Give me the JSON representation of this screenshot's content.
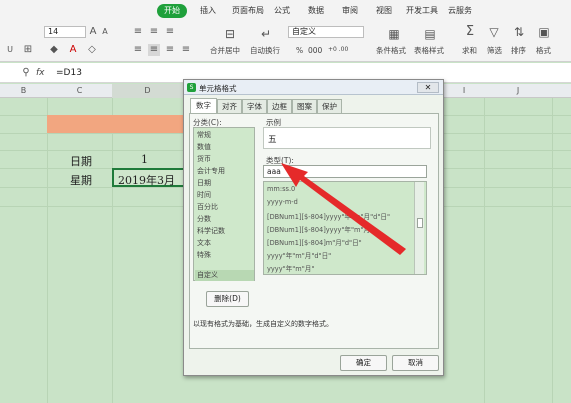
{
  "menu": {
    "items": [
      "开始",
      "插入",
      "页面布局",
      "公式",
      "数据",
      "审阅",
      "视图",
      "开发工具",
      "云服务"
    ]
  },
  "ribbon": {
    "font_size": "14",
    "number_format": "自定义",
    "merge_label": "合并居中",
    "wrap_label": "自动换行",
    "cond_format_label": "条件格式",
    "table_style_label": "表格样式",
    "sum_label": "求和",
    "filter_label": "筛选",
    "sort_label": "排序",
    "format_label": "格式",
    "percent_symbol": "%",
    "comma_symbol": "000",
    "decimals_inc": "+0 .00",
    "decimals_dec": ".00 +.0"
  },
  "formula_bar": {
    "fx": "fx",
    "formula": "=D13"
  },
  "columns": [
    "B",
    "C",
    "D",
    "I",
    "J"
  ],
  "sheet": {
    "row1_label": "日期",
    "row1_value": "1",
    "row2_label": "星期",
    "row2_value": "2019年3月"
  },
  "dialog": {
    "title": "单元格格式",
    "tabs": [
      "数字",
      "对齐",
      "字体",
      "边框",
      "图案",
      "保护"
    ],
    "category_label": "分类(C):",
    "categories": [
      "常规",
      "数值",
      "货币",
      "会计专用",
      "日期",
      "时间",
      "百分比",
      "分数",
      "科学记数",
      "文本",
      "特殊",
      "自定义"
    ],
    "sample_label": "示例",
    "sample_value": "五",
    "type_label": "类型(T):",
    "type_value": "aaa",
    "type_list": [
      "mm:ss.0",
      "yyyy-m-d",
      "[DBNum1][$-804]yyyy\"年\"m\"月\"d\"日\"",
      "[DBNum1][$-804]yyyy\"年\"m\"月\"",
      "[DBNum1][$-804]m\"月\"d\"日\"",
      "yyyy\"年\"m\"月\"d\"日\"",
      "yyyy\"年\"m\"月\""
    ],
    "delete_button": "删除(D)",
    "hint": "以现有格式为基础，生成自定义的数字格式。",
    "ok_button": "确定",
    "cancel_button": "取消"
  },
  "colors": {
    "accent_green": "#1fa03b",
    "sheet_bg": "#c9e3c7",
    "highlight": "#f2a680",
    "arrow": "#e52a2a"
  }
}
